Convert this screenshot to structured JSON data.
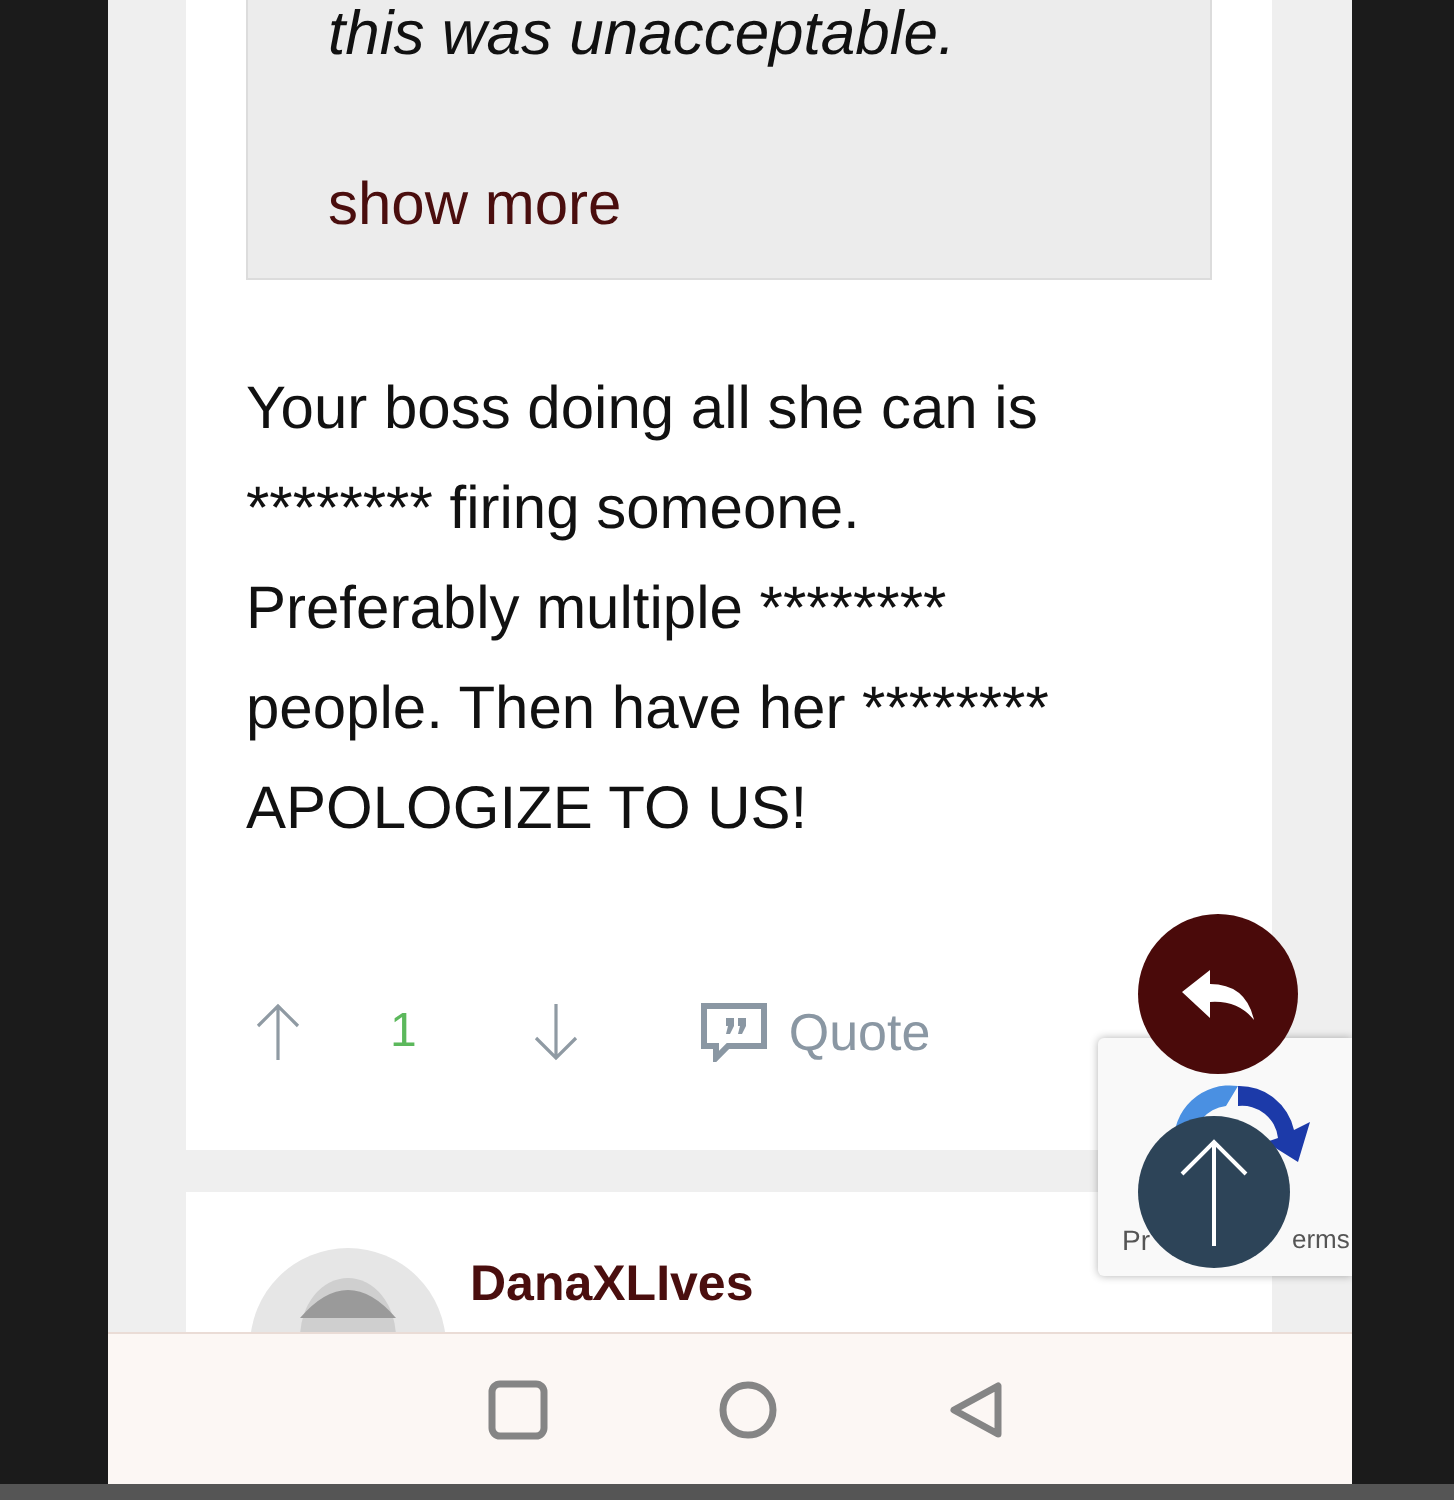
{
  "quote": {
    "text": "this was unacceptable.",
    "show_more": "show more"
  },
  "post": {
    "body": "Your boss doing all she can is ******** firing someone. Preferably multiple ******** people. Then have her ******** APOLOGIZE TO US!",
    "score": "1",
    "quote_label": "Quote"
  },
  "next_post": {
    "author": "DanaXLIves"
  },
  "recaptcha": {
    "privacy": "Pr",
    "terms": "erms"
  }
}
